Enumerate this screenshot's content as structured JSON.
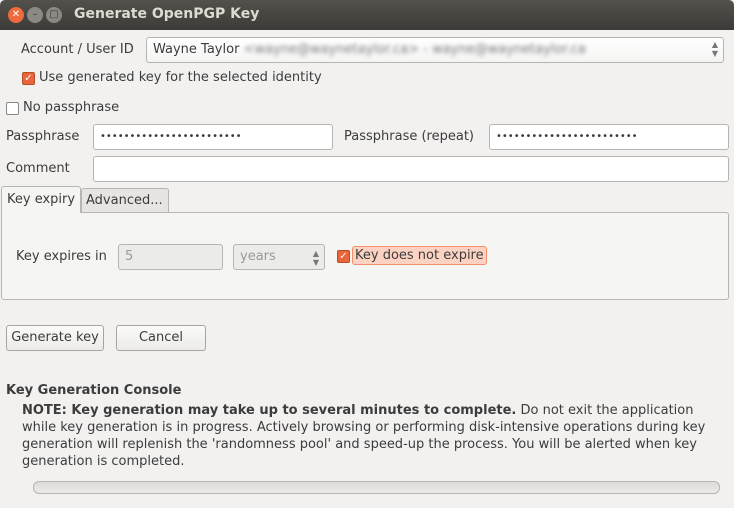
{
  "window": {
    "title": "Generate OpenPGP Key"
  },
  "account": {
    "label": "Account / User ID",
    "name": "Wayne Taylor",
    "email": "<wayne@waynetaylor.ca> - wayne@waynetaylor.ca"
  },
  "use_generated": {
    "label": "Use generated key for the selected identity",
    "checked": true
  },
  "no_passphrase": {
    "label": "No passphrase",
    "checked": false
  },
  "passphrase": {
    "label": "Passphrase",
    "value": "••••••••••••••••••••••••"
  },
  "passphrase_repeat": {
    "label": "Passphrase (repeat)",
    "value": "••••••••••••••••••••••••"
  },
  "comment": {
    "label": "Comment",
    "value": ""
  },
  "tabs": [
    {
      "label": "Key expiry",
      "active": true
    },
    {
      "label": "Advanced..."
    }
  ],
  "expiry": {
    "label": "Key expires in",
    "value": "5",
    "unit": "years",
    "no_expire_label": "Key does not expire",
    "no_expire_checked": true
  },
  "buttons": {
    "generate": "Generate key",
    "cancel": "Cancel"
  },
  "console": {
    "title": "Key Generation Console",
    "note_bold": "NOTE: Key generation may take up to several minutes to complete.",
    "note": " Do not exit the application while key generation is in progress. Actively browsing or performing disk-intensive operations during key generation will replenish the 'randomness pool' and speed-up the process. You will be alerted when key generation is completed.",
    "progress": 0
  },
  "colors": {
    "accent": "#e8663a",
    "titlebar": "#3c3b37"
  }
}
